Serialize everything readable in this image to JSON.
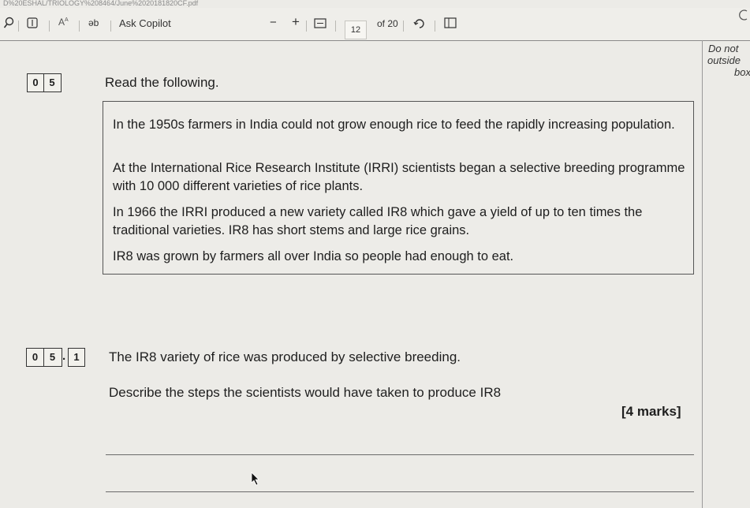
{
  "top_path": "D%20ESHAL/TRIOLOGY%208464/June%2020181820CF.pdf",
  "toolbar": {
    "ask_copilot": "Ask Copilot",
    "zoom_out": "−",
    "zoom_in": "+",
    "current_page": "12",
    "page_total": "of 20"
  },
  "margin_note": {
    "line1": "Do not",
    "line2": "outside",
    "line3": "box"
  },
  "question": {
    "number_digits": [
      "0",
      "5"
    ],
    "prompt": "Read the following."
  },
  "source": {
    "p1": "In the 1950s farmers in India could not grow enough rice to feed the rapidly increasing population.",
    "p2": "At the International Rice Research Institute (IRRI) scientists began a selective breeding programme with 10 000 different varieties of rice plants.",
    "p3": "In 1966 the IRRI produced a new variety called IR8 which gave a yield of up to ten times the traditional varieties.  IR8 has short stems and large rice grains.",
    "p4": "IR8 was grown by farmers all over India so people had enough to eat."
  },
  "subquestion": {
    "number_digits": [
      "0",
      "5"
    ],
    "dot": ".",
    "part": "1",
    "statement": "The IR8 variety of rice was produced by selective breeding.",
    "instruction": "Describe the steps the scientists would have taken to produce IR8",
    "marks": "[4 marks]"
  }
}
